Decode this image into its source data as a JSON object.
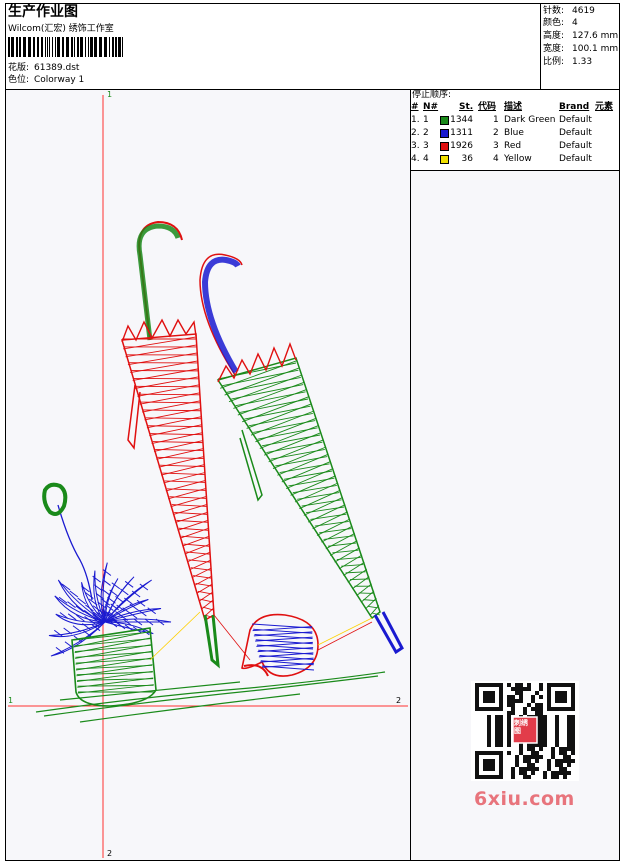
{
  "header": {
    "title": "生产作业图",
    "company": "Wilcom(汇宏) 绣饰工作室",
    "design_label": "花版:",
    "design_value": "61389.dst",
    "colorway_label": "色位:",
    "colorway_value": "Colorway 1"
  },
  "stats": {
    "stitches_label": "针数:",
    "stitches_value": "4619",
    "colors_label": "颜色:",
    "colors_value": "4",
    "height_label": "高度:",
    "height_value": "127.6 mm",
    "width_label": "宽度:",
    "width_value": "100.1 mm",
    "scale_label": "比例:",
    "scale_value": "1.33"
  },
  "stop_sequence": {
    "title": "停止顺序:",
    "columns": [
      "#",
      "N#",
      "St.",
      "代码",
      "描述",
      "Brand",
      "元素"
    ],
    "rows": [
      {
        "idx": "1.",
        "n": "1",
        "color": "#1a8a1a",
        "st": "1344",
        "code": "1",
        "desc": "Dark Green",
        "brand": "Default"
      },
      {
        "idx": "2.",
        "n": "2",
        "color": "#1a1ad0",
        "st": "1311",
        "code": "2",
        "desc": "Blue",
        "brand": "Default"
      },
      {
        "idx": "3.",
        "n": "3",
        "color": "#e01010",
        "st": "1926",
        "code": "3",
        "desc": "Red",
        "brand": "Default"
      },
      {
        "idx": "4.",
        "n": "4",
        "color": "#f0e000",
        "st": "36",
        "code": "4",
        "desc": "Yellow",
        "brand": "Default"
      }
    ]
  },
  "axis_markers": {
    "top": "1",
    "left": "1",
    "right": "2",
    "bottom": "2"
  },
  "watermark": {
    "site": "6xiu.com",
    "seal": "刺绣图"
  },
  "colors": {
    "red": "#e01010",
    "green": "#1a8a1a",
    "blue": "#1a1ad0",
    "yellow": "#f0e000"
  }
}
